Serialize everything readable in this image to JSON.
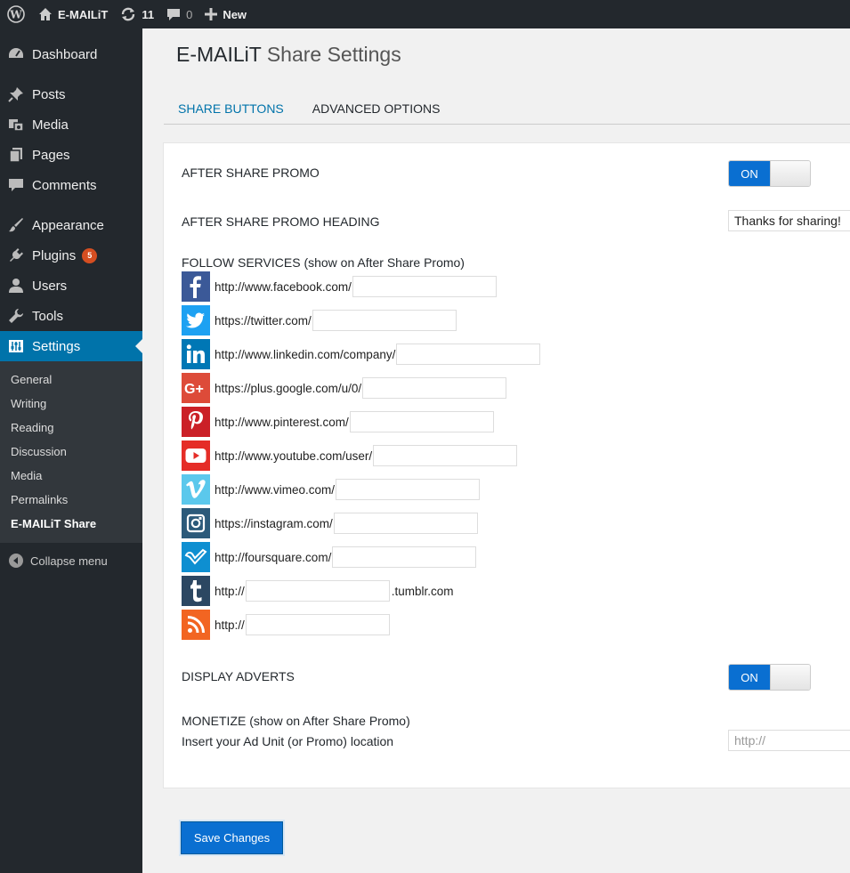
{
  "admin_bar": {
    "site_name": "E-MAILiT",
    "updates_count": "11",
    "comments_count": "0",
    "new_label": "New"
  },
  "sidebar": {
    "items": [
      {
        "label": "Dashboard",
        "icon": "dashboard-icon"
      },
      {
        "label": "Posts",
        "icon": "pin-icon"
      },
      {
        "label": "Media",
        "icon": "media-icon"
      },
      {
        "label": "Pages",
        "icon": "pages-icon"
      },
      {
        "label": "Comments",
        "icon": "comment-icon"
      },
      {
        "label": "Appearance",
        "icon": "brush-icon"
      },
      {
        "label": "Plugins",
        "icon": "plug-icon",
        "badge": "5"
      },
      {
        "label": "Users",
        "icon": "user-icon"
      },
      {
        "label": "Tools",
        "icon": "wrench-icon"
      },
      {
        "label": "Settings",
        "icon": "sliders-icon"
      }
    ],
    "submenu": [
      "General",
      "Writing",
      "Reading",
      "Discussion",
      "Media",
      "Permalinks",
      "E-MAILiT Share"
    ],
    "collapse_label": "Collapse menu"
  },
  "page": {
    "title_brand": "E-MAILiT",
    "title_rest": "Share Settings",
    "tabs": [
      "SHARE BUTTONS",
      "ADVANCED OPTIONS"
    ],
    "after_share_promo_label": "AFTER SHARE PROMO",
    "after_share_promo_state": "ON",
    "heading_label": "AFTER SHARE PROMO HEADING",
    "heading_value": "Thanks for sharing!",
    "follow_label": "FOLLOW SERVICES (show on After Share Promo)",
    "services": [
      {
        "name": "facebook",
        "url": "http://www.facebook.com/",
        "suffix": "",
        "color": "#3b5998"
      },
      {
        "name": "twitter",
        "url": "https://twitter.com/",
        "suffix": "",
        "color": "#1da1f2"
      },
      {
        "name": "linkedin",
        "url": "http://www.linkedin.com/company/",
        "suffix": "",
        "color": "#0077b5"
      },
      {
        "name": "google-plus",
        "url": "https://plus.google.com/u/0/",
        "suffix": "",
        "color": "#dd4b39"
      },
      {
        "name": "pinterest",
        "url": "http://www.pinterest.com/",
        "suffix": "",
        "color": "#cb2027"
      },
      {
        "name": "youtube",
        "url": "http://www.youtube.com/user/",
        "suffix": "",
        "color": "#e52d27"
      },
      {
        "name": "vimeo",
        "url": "http://www.vimeo.com/",
        "suffix": "",
        "color": "#5bc8ec"
      },
      {
        "name": "instagram",
        "url": "https://instagram.com/",
        "suffix": "",
        "color": "#2c5a7a"
      },
      {
        "name": "foursquare",
        "url": "http://foursquare.com/",
        "suffix": "",
        "color": "#0e8fd1"
      },
      {
        "name": "tumblr",
        "url": "http://",
        "suffix": ".tumblr.com",
        "color": "#2c4762"
      },
      {
        "name": "rss",
        "url": "http://",
        "suffix": "",
        "color": "#f26522"
      }
    ],
    "display_adverts_label": "DISPLAY ADVERTS",
    "display_adverts_state": "ON",
    "monetize_label": "MONETIZE (show on After Share Promo)",
    "ad_location_label": "Insert your Ad Unit (or Promo) location",
    "ad_location_placeholder": "http://",
    "save_label": "Save Changes"
  }
}
